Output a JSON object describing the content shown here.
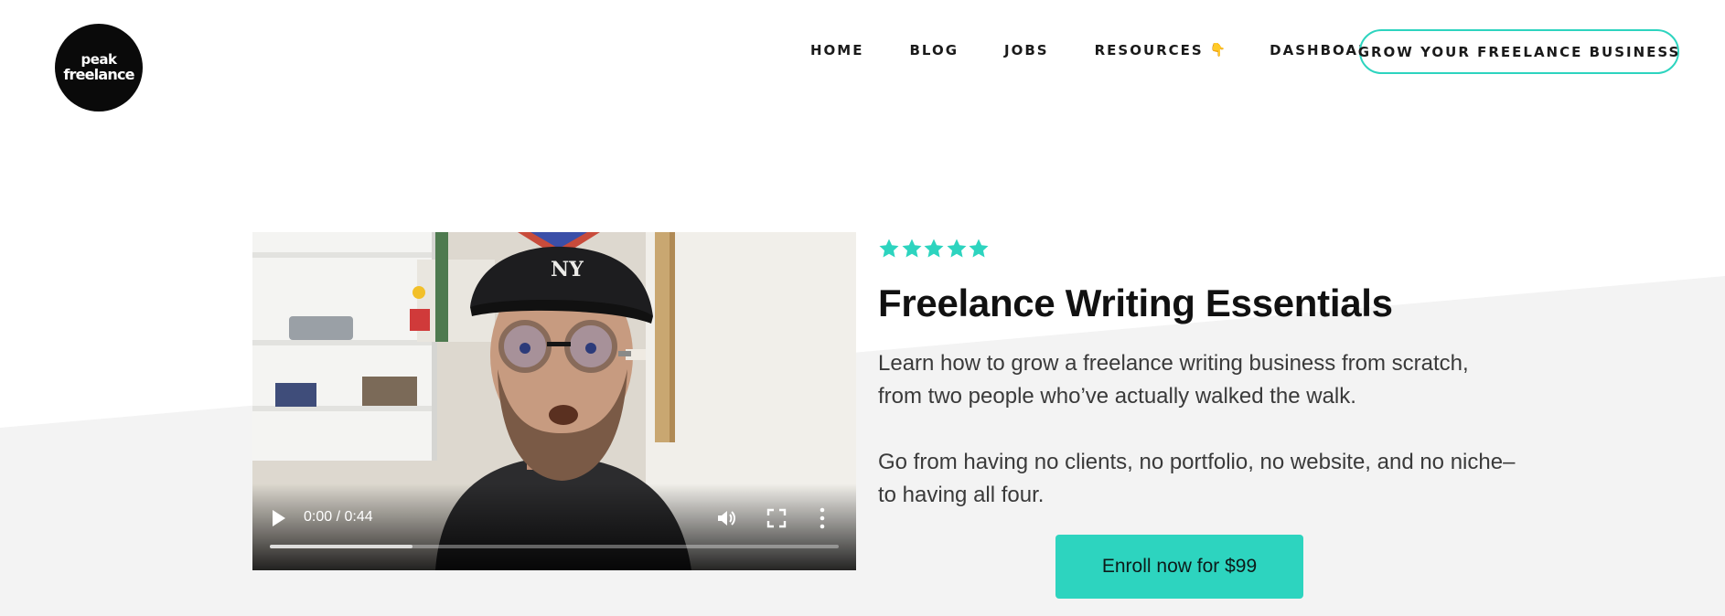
{
  "brand": {
    "logo_line1": "peak",
    "logo_line2": "freelance"
  },
  "nav": {
    "home": "HOME",
    "blog": "BLOG",
    "jobs": "JOBS",
    "resources": "RESOURCES",
    "resources_icon": "pointing-down-hand-icon",
    "dashboard": "DASHBOARD",
    "cta": "GROW YOUR FREELANCE BUSINESS"
  },
  "video": {
    "time": "0:00 / 0:44",
    "buffered_fraction": 0.25,
    "controls": [
      "play-icon",
      "volume-icon",
      "fullscreen-icon",
      "more-options-icon"
    ]
  },
  "course": {
    "rating_stars": 5,
    "title": "Freelance Writing Essentials",
    "paragraph1": "Learn how to grow a freelance writing business from scratch, from two people who’ve actually walked the walk.",
    "paragraph2": "Go from having no clients, no portfolio, no website, and no niche–to having all four.",
    "enroll_label": "Enroll now for $99"
  },
  "colors": {
    "accent": "#2dd4bf",
    "background_band": "#f3f3f3",
    "text_dark": "#111111"
  }
}
